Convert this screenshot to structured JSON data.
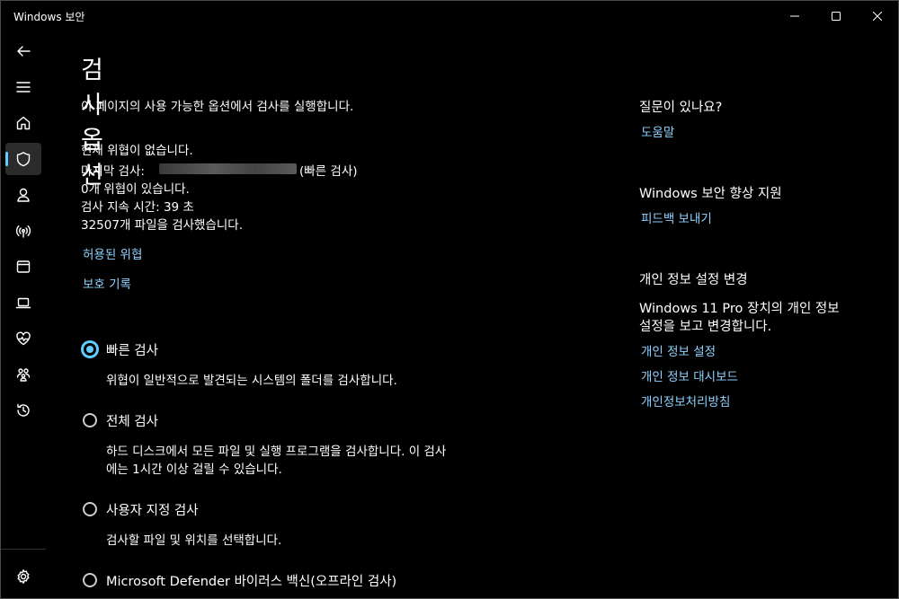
{
  "window": {
    "title": "Windows 보안"
  },
  "page": {
    "title": "검사 옵션",
    "subtitle": "이 페이지의 사용 가능한 옵션에서 검사를 실행합니다."
  },
  "status": {
    "no_threats": "현재 위협이 없습니다.",
    "last_scan_label": "마지막 검사:",
    "last_scan_type": "(빠른 검사)",
    "threat_count": "0개 위협이 있습니다.",
    "duration": "검사 지속 시간: 39 초",
    "files_scanned": "32507개 파일을 검사했습니다."
  },
  "links": {
    "allowed_threats": "허용된 위협",
    "protection_history": "보호 기록"
  },
  "scan_options": [
    {
      "label": "빠른 검사",
      "description": "위협이 일반적으로 발견되는 시스템의 폴더를 검사합니다.",
      "selected": true
    },
    {
      "label": "전체 검사",
      "description": "하드 디스크에서 모든 파일 및 실행 프로그램을 검사합니다. 이 검사",
      "description2": "에는 1시간 이상 걸릴 수 있습니다.",
      "selected": false
    },
    {
      "label": "사용자 지정 검사",
      "description": "검사할 파일 및 위치를 선택합니다.",
      "selected": false
    },
    {
      "label": "Microsoft Defender 바이러스 백신(오프라인 검사)",
      "selected": false
    }
  ],
  "right_panel": {
    "help": {
      "heading": "질문이 있나요?",
      "link": "도움말"
    },
    "improve": {
      "heading": "Windows 보안 향상 지원",
      "link": "피드백 보내기"
    },
    "privacy": {
      "heading": "개인 정보 설정 변경",
      "text1": "Windows 11 Pro 장치의 개인 정보",
      "text2": "설정을 보고 변경합니다.",
      "link1": "개인 정보 설정",
      "link2": "개인 정보 대시보드",
      "link3": "개인정보처리방침"
    }
  },
  "colors": {
    "accent": "#60cdff",
    "link": "#8fd2ff",
    "background": "#000000"
  }
}
